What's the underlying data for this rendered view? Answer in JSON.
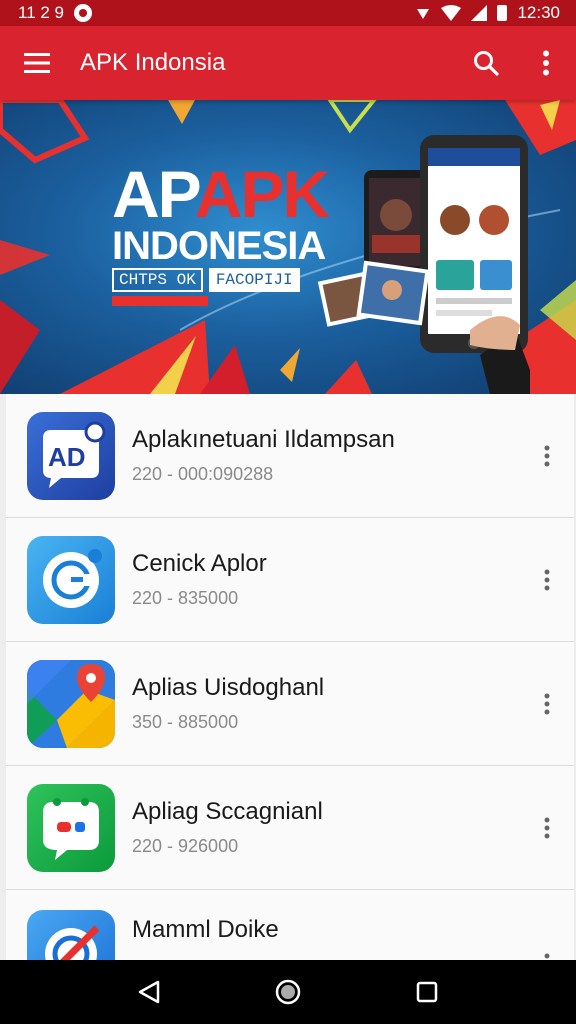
{
  "status_bar": {
    "left_text": "11 2 9",
    "time": "12:30"
  },
  "app_bar": {
    "title": "APK Indonsia",
    "icons": [
      "menu-icon",
      "search-icon",
      "more-vert-icon"
    ]
  },
  "banner": {
    "title_part1": "AP",
    "title_part2": "APK",
    "subtitle": "INDONESIA",
    "tag_left": "CHTPS OK",
    "tag_right": "FACOPIJI",
    "colors": {
      "accent": "#e8312e",
      "background": "#1b5f9e"
    }
  },
  "apps": [
    {
      "name": "Aplakınetuani Ildampsan",
      "meta": "220 - 000:090288",
      "icon": "chat-ad-icon",
      "icon_text": "AD"
    },
    {
      "name": "Cenick Aplor",
      "meta": "220 - 835000",
      "icon": "sync-circle-icon",
      "icon_text": ""
    },
    {
      "name": "Aplias Uisdoghanl",
      "meta": "350 - 885000",
      "icon": "maps-pin-icon",
      "icon_text": ""
    },
    {
      "name": "Apliag Sccagnianl",
      "meta": "220 - 926000",
      "icon": "chat-green-icon",
      "icon_text": ""
    },
    {
      "name": "Mamml Doike",
      "meta": "",
      "icon": "blocked-app-icon",
      "icon_text": ""
    }
  ],
  "theme": {
    "primary": "#d9232e",
    "status_bar": "#b0121b"
  }
}
